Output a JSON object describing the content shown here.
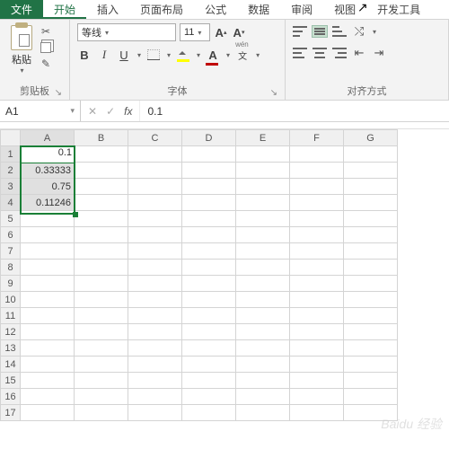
{
  "tabs": {
    "file": "文件",
    "home": "开始",
    "insert": "插入",
    "layout": "页面布局",
    "formula": "公式",
    "data": "数据",
    "review": "审阅",
    "view": "视图",
    "developer": "开发工具"
  },
  "ribbon": {
    "clipboard": {
      "paste": "粘贴",
      "label": "剪贴板"
    },
    "font": {
      "name": "等线",
      "size": "11",
      "bold": "B",
      "italic": "I",
      "underline": "U",
      "color_letter": "A",
      "phonetic": "文",
      "grow": "A",
      "shrink": "A",
      "label": "字体"
    },
    "align": {
      "label": "对齐方式"
    }
  },
  "formula_bar": {
    "name_box": "A1",
    "cancel": "✕",
    "enter": "✓",
    "fx": "fx",
    "value": "0.1"
  },
  "columns": [
    "A",
    "B",
    "C",
    "D",
    "E",
    "F",
    "G"
  ],
  "rows": [
    "1",
    "2",
    "3",
    "4",
    "5",
    "6",
    "7",
    "8",
    "9",
    "10",
    "11",
    "12",
    "13",
    "14",
    "15",
    "16",
    "17"
  ],
  "cells": {
    "A1": "0.1",
    "A2": "0.33333",
    "A3": "0.75",
    "A4": "0.11246"
  },
  "watermark": "Baidu 经验"
}
